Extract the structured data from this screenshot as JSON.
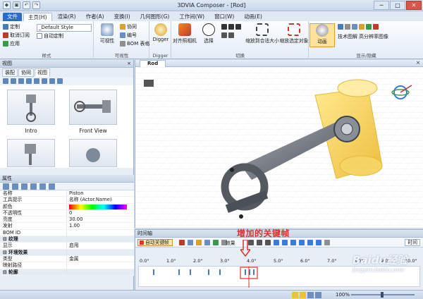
{
  "window": {
    "title": "3DVIA Composer - [Rod]",
    "minimize": "─",
    "maximize": "□",
    "close": "✕"
  },
  "ribbon_tabs": [
    {
      "label": "文件"
    },
    {
      "label": "主页(H)"
    },
    {
      "label": "渲染(R)"
    },
    {
      "label": "作者(A)"
    },
    {
      "label": "变换(I)"
    },
    {
      "label": "几何图形(G)"
    },
    {
      "label": "工作间(W)"
    },
    {
      "label": "窗口(W)"
    },
    {
      "label": "动画(E)"
    }
  ],
  "ribbon": {
    "style_group": {
      "label": "样式",
      "define": "定制",
      "cancel_define": "取消订阅",
      "apply": "应用",
      "auto_define": "自动定制",
      "style_value": "_Default Style"
    },
    "visibility_group": {
      "label": "可视性",
      "visibility": "可视性",
      "coop": "协同",
      "number": "编号",
      "bom": "BOM 表格"
    },
    "digger_group": {
      "label": "Digger",
      "digger": "Digger"
    },
    "switch_group": {
      "label": "切换",
      "align_camera": "对齐照相机",
      "select": "选择",
      "zoom_fit": "缩放到合适大小",
      "zoom_selected": "缩放选定对象"
    },
    "display_group": {
      "label": "显示/隐藏",
      "animation": "动画",
      "tech_illustration": "技术图解",
      "hires_image": "高分辨率图像"
    }
  },
  "left_panel": {
    "title": "视图",
    "close": "×",
    "tabs": [
      {
        "label": "装配"
      },
      {
        "label": "协同"
      },
      {
        "label": "视图"
      }
    ],
    "thumbnails": [
      {
        "label": "Intro"
      },
      {
        "label": "Front View"
      }
    ]
  },
  "properties": {
    "title": "属性",
    "rows": [
      {
        "k": "名称",
        "v": "Piston"
      },
      {
        "k": "工具提示",
        "v": "名称 (Actor.Name)"
      },
      {
        "k": "颜色",
        "v": ""
      },
      {
        "k": "不透明性",
        "v": "0"
      },
      {
        "k": "亮度",
        "v": "30.00"
      },
      {
        "k": "发射",
        "v": "1.00"
      },
      {
        "k": "BOM ID",
        "v": ""
      },
      {
        "k": "⊟ 纹理",
        "v": "",
        "sec": true
      },
      {
        "k": "显示",
        "v": "启用"
      },
      {
        "k": "⊟ 环境效果",
        "v": "",
        "sec": true
      },
      {
        "k": "类型",
        "v": "金属"
      },
      {
        "k": "映射路径",
        "v": ""
      },
      {
        "k": "⊟ 轮廓",
        "v": "",
        "sec": true
      }
    ]
  },
  "viewport": {
    "tab": "Rod",
    "close": "×"
  },
  "timeline": {
    "title": "时间轴",
    "autokey": "自动关键帧",
    "effect": "效果",
    "time_mode": "时间",
    "ticks": [
      "0.0\"",
      "1.0\"",
      "2.0\"",
      "3.0\"",
      "4.0\"",
      "5.0\"",
      "6.0\"",
      "7.0\"",
      "8.0\"",
      "9.0\"",
      "10.0\""
    ]
  },
  "annotation": "增加的关键帧",
  "watermark": {
    "main": "Baidu经验",
    "sub": "jingyan.baidu.com"
  },
  "status": {
    "zoom": "100%"
  }
}
